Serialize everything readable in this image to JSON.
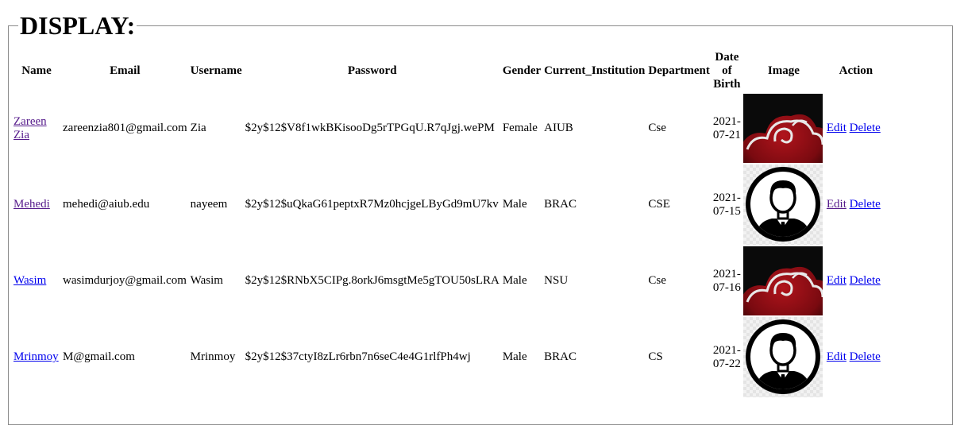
{
  "legend": "DISPLAY:",
  "headers": {
    "name": "Name",
    "email": "Email",
    "username": "Username",
    "password": "Password",
    "gender": "Gender",
    "institution": "Current_Institution",
    "department": "Department",
    "dob_line1": "Date",
    "dob_line2": "of",
    "dob_line3": "Birth",
    "image": "Image",
    "action": "Action"
  },
  "actions": {
    "edit": "Edit",
    "delete": "Delete"
  },
  "rows": [
    {
      "name_line1": "Zareen",
      "name_line2": "Zia",
      "email": "zareenzia801@gmail.com",
      "username": "Zia",
      "password": "$2y$12$V8f1wkBKisooDg5rTPGqU.R7qJgj.wePM",
      "gender": "Female",
      "institution": "AIUB",
      "department": "Cse",
      "dob_line1": "2021-",
      "dob_line2": "07-21",
      "image": "red-cloud-avatar-icon"
    },
    {
      "name": "Mehedi",
      "email": "mehedi@aiub.edu",
      "username": "nayeem",
      "password": "$2y$12$uQkaG61peptxR7Mz0hcjgeLByGd9mU7kv",
      "gender": "Male",
      "institution": "BRAC",
      "department": "CSE",
      "dob_line1": "2021-",
      "dob_line2": "07-15",
      "image": "user-silhouette-icon"
    },
    {
      "name": "Wasim",
      "email": "wasimdurjoy@gmail.com",
      "username": "Wasim",
      "password": "$2y$12$RNbX5CIPg.8orkJ6msgtMe5gTOU50sLRA",
      "gender": "Male",
      "institution": "NSU",
      "department": "Cse",
      "dob_line1": "2021-",
      "dob_line2": "07-16",
      "image": "red-cloud-avatar-icon"
    },
    {
      "name": "Mrinmoy",
      "email": "M@gmail.com",
      "username": "Mrinmoy",
      "password": "$2y$12$37ctyI8zLr6rbn7n6seC4e4G1rlfPh4wj",
      "gender": "Male",
      "institution": "BRAC",
      "department": "CS",
      "dob_line1": "2021-",
      "dob_line2": "07-22",
      "image": "user-silhouette-icon"
    }
  ]
}
